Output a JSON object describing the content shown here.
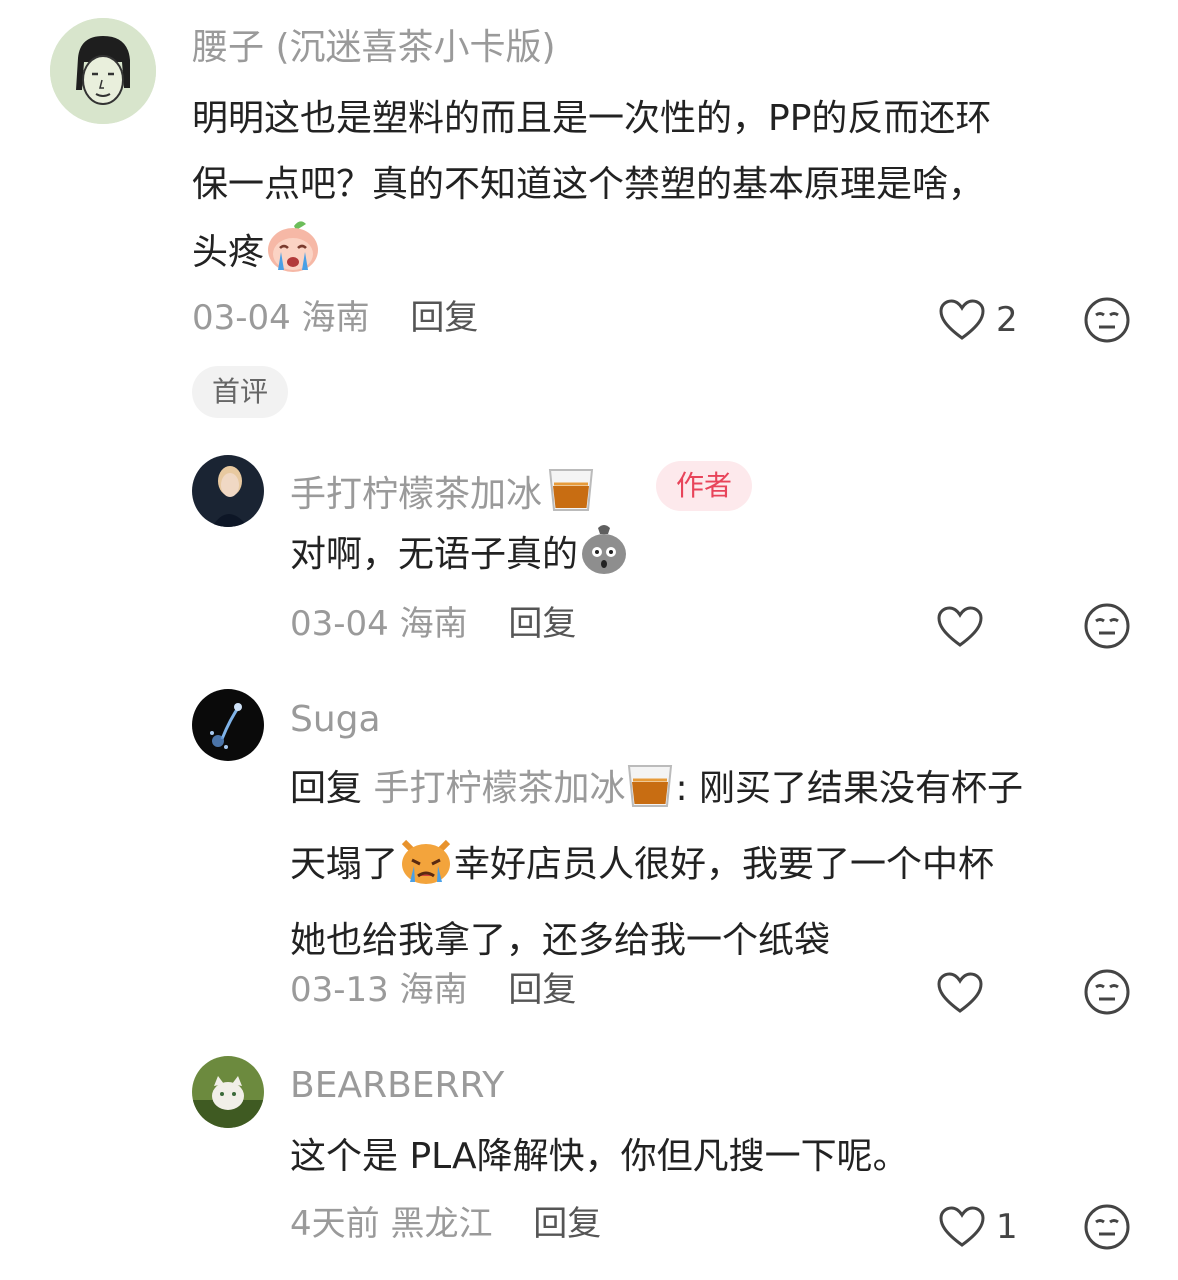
{
  "comments": [
    {
      "username": "腰子 (沉迷喜茶小卡版)",
      "content_line1": "明明这也是塑料的而且是一次性的，PP的反而还环",
      "content_line2": "保一点吧？真的不知道这个禁塑的基本原理是啥，",
      "content_line3": "头疼",
      "content_emoji": "crying-peach-emoji",
      "date": "03-04",
      "location": "海南",
      "reply_label": "回复",
      "likes": "2",
      "tag": "首评"
    },
    {
      "username": "手打柠檬茶加冰",
      "username_emoji": "whiskey-glass-emoji",
      "badge": "作者",
      "content": "对啊，无语子真的",
      "content_emoji": "shocked-bag-emoji",
      "date": "03-04",
      "location": "海南",
      "reply_label": "回复",
      "likes": ""
    },
    {
      "username": "Suga",
      "reply_prefix": "回复",
      "reply_target": "手打柠檬茶加冰",
      "reply_colon": ": 刚买了结果没有杯子",
      "content_line2a": "天塌了",
      "content_emoji": "crying-cat-emoji",
      "content_line2b": "幸好店员人很好，我要了一个中杯",
      "content_line3": "她也给我拿了，还多给我一个纸袋",
      "date": "03-13",
      "location": "海南",
      "reply_label": "回复",
      "likes": ""
    },
    {
      "username": "BEARBERRY",
      "content": "这个是 PLA降解快，你但凡搜一下呢。",
      "date": "4天前",
      "location": "黑龙江",
      "reply_label": "回复",
      "likes": "1"
    }
  ],
  "colors": {
    "author_badge_bg": "#fde9ec",
    "author_badge_text": "#e8445a",
    "meta": "#9a9a9a"
  }
}
